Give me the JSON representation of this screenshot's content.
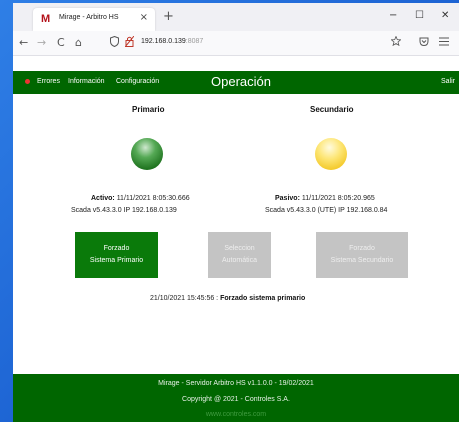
{
  "browser": {
    "tab_title": "Mirage - Arbitro HS",
    "tab_close": "×",
    "new_tab": "+",
    "window": {
      "minimize": "−",
      "maximize": "☐",
      "close": "✕"
    },
    "nav": {
      "back": "←",
      "forward": "→",
      "reload": "C",
      "home": "⌂"
    },
    "url_host": "192.168.0.139",
    "url_port": ":8087"
  },
  "menu": {
    "errors": "Errores",
    "info": "Información",
    "config": "Configuración",
    "title": "Operación",
    "exit": "Salir"
  },
  "primary": {
    "heading": "Primario",
    "status_label": "Activo:",
    "timestamp": "11/11/2021 8:05:30.666",
    "scada": "Scada v5.43.3.0 IP 192.168.0.139",
    "lamp_color": "#1a6e1a"
  },
  "secondary": {
    "heading": "Secundario",
    "status_label": "Pasivo:",
    "timestamp": "11/11/2021 8:05:20.965",
    "scada": "Scada v5.43.3.0 (UTE) IP 192.168.0.84",
    "lamp_color": "#f2c41c"
  },
  "buttons": {
    "force_primary": {
      "line1": "Forzado",
      "line2": "Sistema Primario"
    },
    "auto": {
      "line1": "Seleccion",
      "line2": "Automática"
    },
    "force_secondary": {
      "line1": "Forzado",
      "line2": "Sistema Secundario"
    }
  },
  "log": {
    "timestamp": "21/10/2021 15:45:56 :",
    "message": "Forzado sistema primario"
  },
  "footer": {
    "line1": "Mirage - Servidor Arbitro HS v1.1.0.0 - 19/02/2021",
    "line2": "Copyright @ 2021 - Controles S.A.",
    "link": "www.controles.com"
  },
  "colors": {
    "brand_green": "#006600",
    "active_button": "#0a7a0a",
    "inactive_button": "#c4c4c4"
  }
}
